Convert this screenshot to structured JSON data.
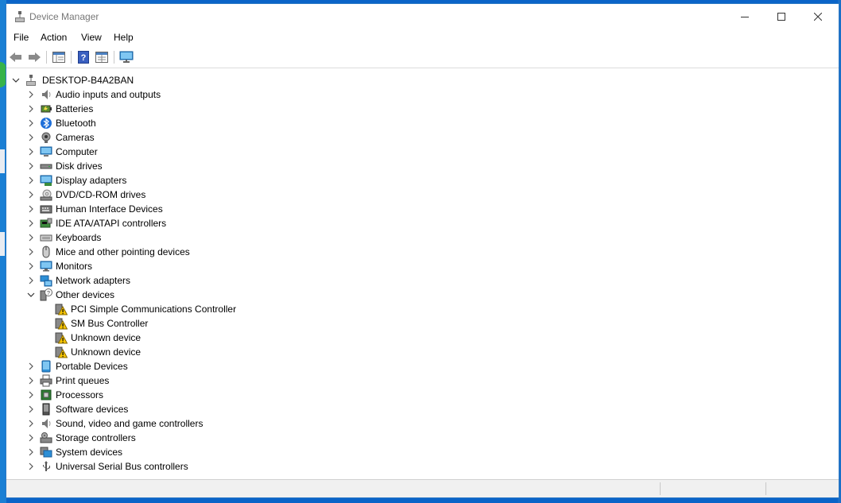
{
  "window": {
    "title": "Device Manager"
  },
  "menu": [
    "File",
    "Action",
    "View",
    "Help"
  ],
  "toolbar": [
    "back-arrow-icon",
    "forward-arrow-icon",
    "properties-pane-icon",
    "help-icon",
    "properties-grid-icon",
    "monitor-scan-icon"
  ],
  "tree": {
    "root": "DESKTOP-B4A2BAN",
    "categories": [
      {
        "label": "Audio inputs and outputs",
        "icon": "speaker-icon",
        "expanded": false
      },
      {
        "label": "Batteries",
        "icon": "battery-icon",
        "expanded": false
      },
      {
        "label": "Bluetooth",
        "icon": "bluetooth-icon",
        "expanded": false
      },
      {
        "label": "Cameras",
        "icon": "camera-icon",
        "expanded": false
      },
      {
        "label": "Computer",
        "icon": "computer-icon",
        "expanded": false
      },
      {
        "label": "Disk drives",
        "icon": "disk-drive-icon",
        "expanded": false
      },
      {
        "label": "Display adapters",
        "icon": "display-adapter-icon",
        "expanded": false
      },
      {
        "label": "DVD/CD-ROM drives",
        "icon": "dvd-drive-icon",
        "expanded": false
      },
      {
        "label": "Human Interface Devices",
        "icon": "hid-icon",
        "expanded": false
      },
      {
        "label": "IDE ATA/ATAPI controllers",
        "icon": "ide-controller-icon",
        "expanded": false
      },
      {
        "label": "Keyboards",
        "icon": "keyboard-icon",
        "expanded": false
      },
      {
        "label": "Mice and other pointing devices",
        "icon": "mouse-icon",
        "expanded": false
      },
      {
        "label": "Monitors",
        "icon": "monitor-icon",
        "expanded": false
      },
      {
        "label": "Network adapters",
        "icon": "network-adapter-icon",
        "expanded": false
      },
      {
        "label": "Other devices",
        "icon": "unknown-device-icon",
        "expanded": true,
        "children": [
          "PCI Simple Communications Controller",
          "SM Bus Controller",
          "Unknown device",
          "Unknown device"
        ]
      },
      {
        "label": "Portable Devices",
        "icon": "portable-device-icon",
        "expanded": false
      },
      {
        "label": "Print queues",
        "icon": "printer-icon",
        "expanded": false
      },
      {
        "label": "Processors",
        "icon": "processor-icon",
        "expanded": false
      },
      {
        "label": "Software devices",
        "icon": "software-device-icon",
        "expanded": false
      },
      {
        "label": "Sound, video and game controllers",
        "icon": "sound-controller-icon",
        "expanded": false
      },
      {
        "label": "Storage controllers",
        "icon": "storage-controller-icon",
        "expanded": false
      },
      {
        "label": "System devices",
        "icon": "system-devices-icon",
        "expanded": false
      },
      {
        "label": "Universal Serial Bus controllers",
        "icon": "usb-icon",
        "expanded": false
      }
    ]
  },
  "colors": {
    "accent": "#0078d7",
    "warning": "#f5c400",
    "window_border": "#2b78c4"
  }
}
